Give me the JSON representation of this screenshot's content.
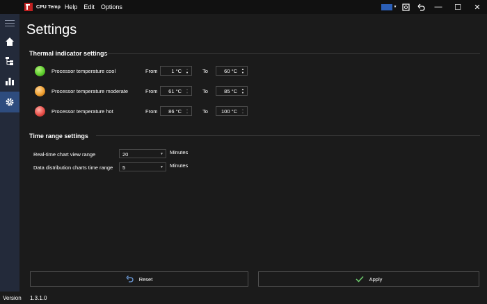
{
  "app": {
    "title": "CPU Temp"
  },
  "menu": {
    "items": [
      "Help",
      "Edit",
      "Options"
    ]
  },
  "colors": {
    "sidebar_bg": "#232a3a",
    "sidebar_active": "#2e4c7e",
    "cool": "#5ecf2e",
    "moderate": "#f0a030",
    "hot": "#e8504a",
    "apply_check": "#6fd06f",
    "reset_icon": "#6f9fe0"
  },
  "page": {
    "title": "Settings"
  },
  "thermal": {
    "title": "Thermal indicator settings",
    "from_label": "From",
    "to_label": "To",
    "rows": [
      {
        "label": "Processor temperature cool",
        "from": "1 °C",
        "to": "60 °C"
      },
      {
        "label": "Processor temperature moderate",
        "from": "61 °C",
        "to": "85 °C"
      },
      {
        "label": "Processor temperature hot",
        "from": "86 °C",
        "to": "100 °C"
      }
    ]
  },
  "time_range": {
    "title": "Time range settings",
    "realtime": {
      "label": "Real-time chart view range",
      "value": "20",
      "unit": "Minutes"
    },
    "distribution": {
      "label": "Data distribution charts time range",
      "value": "5",
      "unit": "Minutes"
    }
  },
  "buttons": {
    "reset": "Reset",
    "apply": "Apply"
  },
  "status": {
    "version_label": "Version",
    "version": "1.3.1.0"
  },
  "sidebar": {
    "icons": [
      "menu-icon",
      "home-icon",
      "tree-icon",
      "bar-chart-icon",
      "gear-icon"
    ]
  }
}
